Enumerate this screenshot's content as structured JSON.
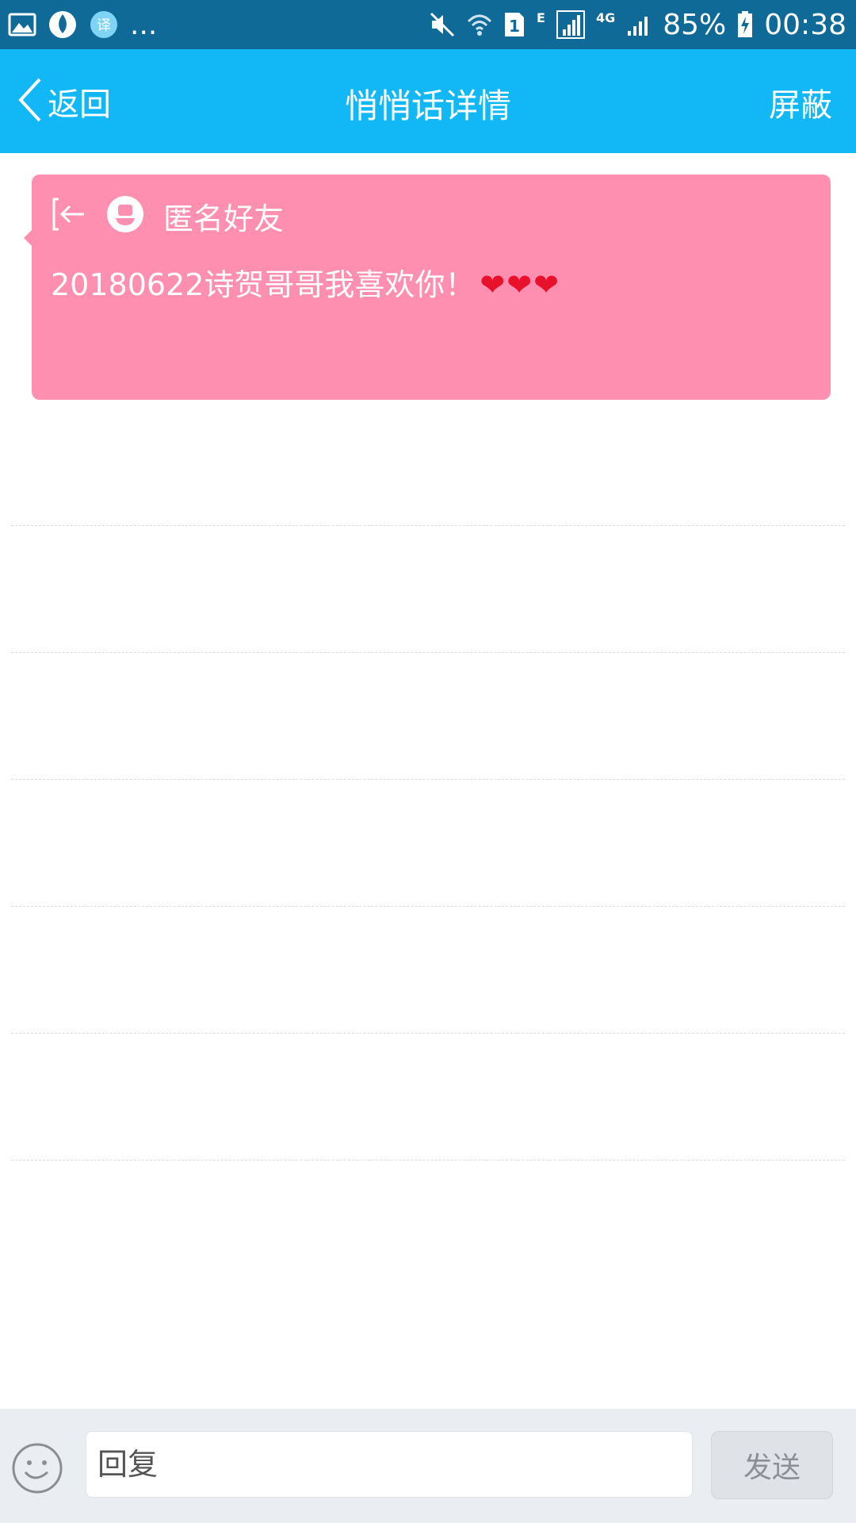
{
  "status_bar": {
    "overflow": "...",
    "network_e": "E",
    "network_4g": "4G",
    "sim_slot": "1",
    "battery": "85%",
    "time": "00:38",
    "icons": [
      "gallery-icon",
      "app-notification-icon",
      "translate-icon",
      "mute-icon",
      "wifi-icon",
      "sim-icon",
      "signal-icon",
      "signal-icon",
      "battery-charging-icon"
    ]
  },
  "titlebar": {
    "back_label": "返回",
    "title": "悄悄话详情",
    "block_label": "屏蔽",
    "background": "#12b7f5"
  },
  "message": {
    "sender": "匿名好友",
    "text": "20180622诗贺哥哥我喜欢你！",
    "hearts": "❤❤❤",
    "background": "#ff8fb0"
  },
  "reply_bar": {
    "placeholder": "回复",
    "send_label": "发送"
  }
}
